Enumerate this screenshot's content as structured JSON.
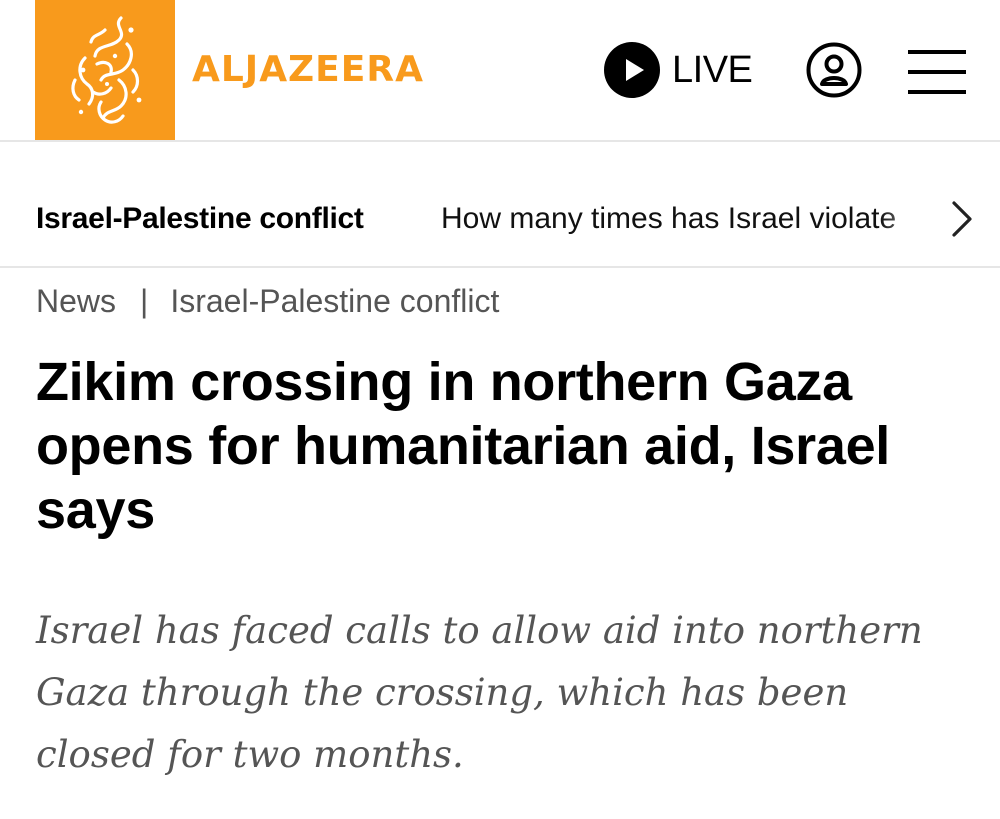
{
  "header": {
    "brand_name": "ALJAZEERA",
    "brand_color": "#F89A1C",
    "logo_icon": "aljazeera-calligraphy-logo",
    "live_label": "LIVE",
    "live_icon": "play-icon",
    "account_icon": "user-account-icon",
    "menu_icon": "hamburger-menu-icon"
  },
  "trending": {
    "topic": "Israel-Palestine conflict",
    "headline": "How many times has Israel violate",
    "next_icon": "chevron-right-icon"
  },
  "article": {
    "breadcrumb": [
      "News",
      "Israel-Palestine conflict"
    ],
    "breadcrumb_separator": "|",
    "headline": "Zikim crossing in northern Gaza opens for humanitarian aid, Israel says",
    "subheading": "Israel has faced calls to allow aid into northern Gaza through the crossing, which has been closed for two months."
  }
}
